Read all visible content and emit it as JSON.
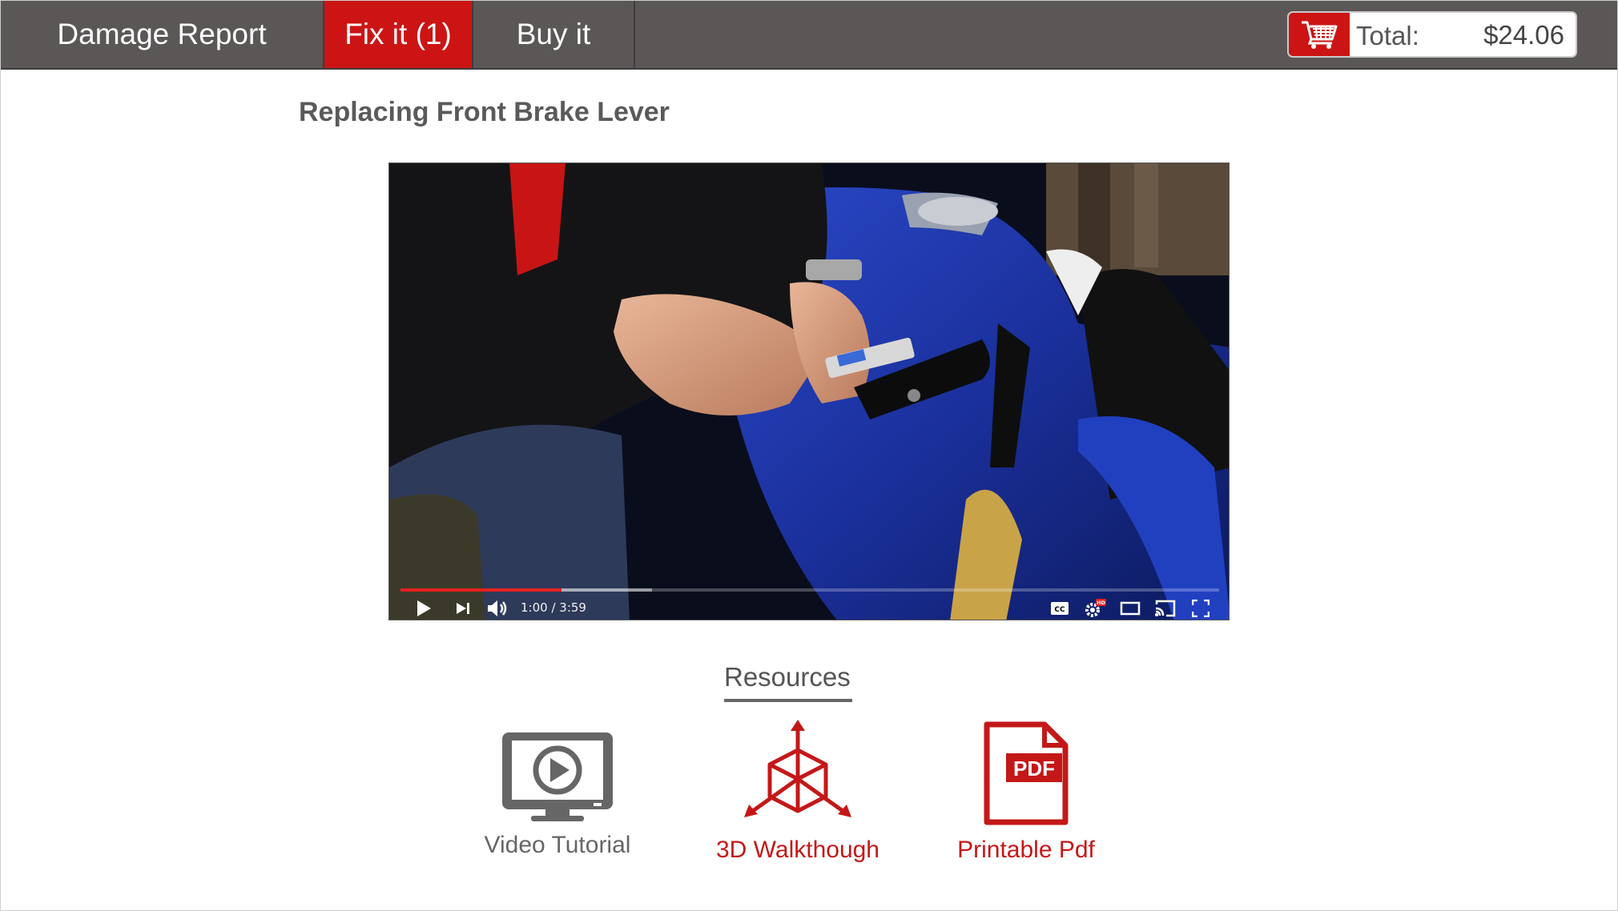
{
  "nav": {
    "tabs": [
      {
        "label": "Damage Report"
      },
      {
        "label": "Fix it (1)"
      },
      {
        "label": "Buy it"
      }
    ],
    "active_tab": "Fix it (1)",
    "cart": {
      "total_label": "Total:",
      "total_value": "$24.06",
      "icon": "shopping-cart-icon"
    }
  },
  "main": {
    "title": "Replacing Front Brake Lever",
    "video": {
      "current_time": "1:00 / 3:59",
      "played_fraction": 0.197,
      "buffered_fraction": 0.307,
      "controls": [
        "play-icon",
        "next-icon",
        "volume-icon",
        "captions-icon",
        "settings-icon",
        "theater-icon",
        "cast-icon",
        "fullscreen-icon"
      ],
      "hd_badge": "HD"
    }
  },
  "resources": {
    "heading": "Resources",
    "items": [
      {
        "label": "Video Tutorial",
        "icon": "monitor-play-icon",
        "color": "#666666"
      },
      {
        "label": "3D Walkthough",
        "icon": "cube-3d-icon",
        "color": "#c41818"
      },
      {
        "label": "Printable Pdf",
        "icon": "pdf-document-icon",
        "color": "#c41818",
        "badge": "PDF"
      }
    ]
  },
  "colors": {
    "topbar": "#5b5757",
    "accent": "#cc1414",
    "text": "#5a5a5a"
  }
}
